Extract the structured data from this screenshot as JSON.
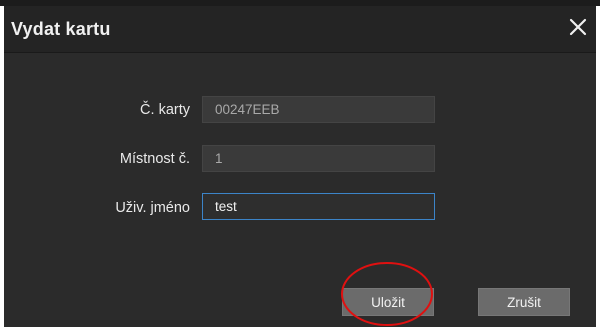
{
  "dialog": {
    "title": "Vydat kartu",
    "close_icon": "close-icon"
  },
  "form": {
    "card_no": {
      "label": "Č. karty",
      "value": "00247EEB"
    },
    "room_no": {
      "label": "Místnost č.",
      "value": "1"
    },
    "user_name": {
      "label": "Uživ. jméno",
      "value": "test"
    }
  },
  "buttons": {
    "save_label": "Uložit",
    "cancel_label": "Zrušit"
  },
  "colors": {
    "dialog_bg": "#2b2b2b",
    "focus_border": "#3c84c8",
    "annotation_circle": "#e01010"
  }
}
